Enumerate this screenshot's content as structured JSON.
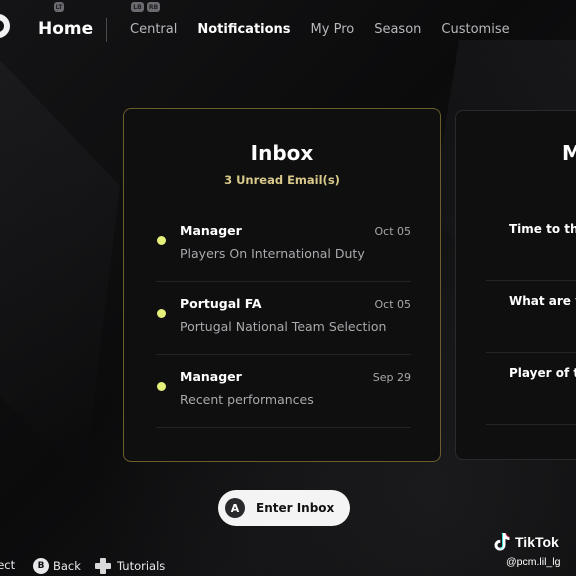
{
  "nav": {
    "home": "Home",
    "tabs": [
      {
        "label": "Central",
        "active": false
      },
      {
        "label": "Notifications",
        "active": true
      },
      {
        "label": "My Pro",
        "active": false
      },
      {
        "label": "Season",
        "active": false
      },
      {
        "label": "Customise",
        "active": false
      }
    ],
    "shoulder_buttons": [
      "LT",
      "LB",
      "RB"
    ]
  },
  "inbox": {
    "title": "Inbox",
    "unread": "3 Unread Email(s)",
    "emails": [
      {
        "from": "Manager",
        "date": "Oct 05",
        "subject": "Players On International Duty",
        "unread": true
      },
      {
        "from": "Portugal FA",
        "date": "Oct 05",
        "subject": "Portugal National Team Selection",
        "unread": true
      },
      {
        "from": "Manager",
        "date": "Sep 29",
        "subject": "Recent performances",
        "unread": true
      }
    ]
  },
  "side_card": {
    "title_fragment": "M",
    "rows": [
      "Time to thin",
      "What are yo",
      "Player of th"
    ]
  },
  "enter_button": {
    "key": "A",
    "label": "Enter Inbox"
  },
  "hints": [
    {
      "key": "",
      "label": "lect"
    },
    {
      "key": "B",
      "label": "Back"
    },
    {
      "key": "dpad",
      "label": "Tutorials"
    }
  ],
  "watermark": {
    "brand": "TikTok",
    "handle": "@pcm.lil_lg"
  },
  "colors": {
    "accent_border": "#6b5e2a",
    "unread_dot": "#e5f07a",
    "unread_text": "#d8c98a"
  }
}
